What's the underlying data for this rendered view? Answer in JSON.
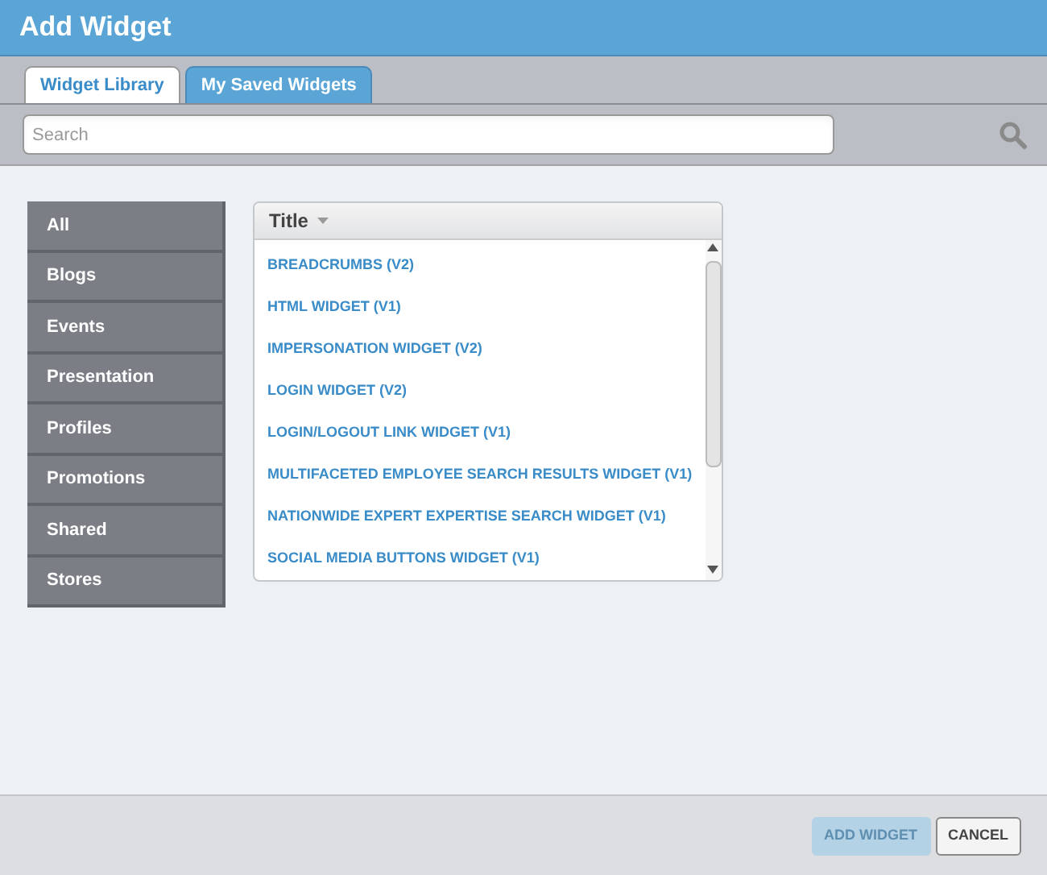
{
  "window": {
    "title": "Add Widget"
  },
  "tabs": [
    {
      "label": "Widget Library",
      "selected": true
    },
    {
      "label": "My Saved Widgets",
      "selected": false
    }
  ],
  "search": {
    "placeholder": "Search"
  },
  "categories": [
    {
      "label": "All"
    },
    {
      "label": "Blogs"
    },
    {
      "label": "Events"
    },
    {
      "label": "Presentation"
    },
    {
      "label": "Profiles"
    },
    {
      "label": "Promotions"
    },
    {
      "label": "Shared"
    },
    {
      "label": "Stores"
    }
  ],
  "table": {
    "columns": [
      "Title"
    ],
    "rows": [
      "BREADCRUMBS (V2)",
      "HTML WIDGET (V1)",
      "IMPERSONATION WIDGET (V2)",
      "LOGIN WIDGET (V2)",
      "LOGIN/LOGOUT LINK WIDGET (V1)",
      "MULTIFACETED EMPLOYEE SEARCH RESULTS WIDGET (V1)",
      "NATIONWIDE EXPERT EXPERTISE SEARCH WIDGET (V1)",
      "SOCIAL MEDIA BUTTONS WIDGET (V1)"
    ]
  },
  "buttons": [
    {
      "label": "ADD WIDGET",
      "disabled": true
    },
    {
      "label": "CANCEL",
      "disabled": false
    }
  ]
}
